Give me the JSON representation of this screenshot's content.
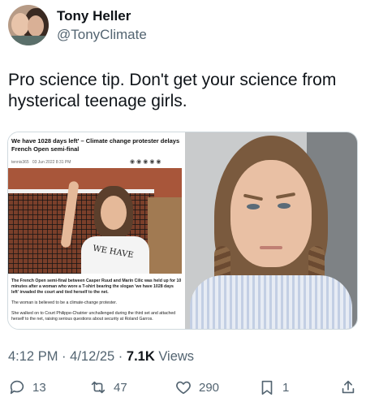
{
  "author": {
    "name": "Tony Heller",
    "handle": "@TonyClimate"
  },
  "tweet": {
    "text": "Pro science tip.  Don't get your science from hysterical teenage girls."
  },
  "article": {
    "headline": "We have 1028 days left' – Climate change protester delays French Open semi-final",
    "source": "tennis365",
    "date": "03 Jun 2022 8:31 PM",
    "shirt_text": "WE HAVE",
    "paragraphs": [
      "The French Open semi-final between Casper Ruud and Marin Cilic was held up for 10 minutes after a woman who wore a T-shirt bearing the slogan 'we have 1028 days left' invaded the court and tied herself to the net.",
      "The woman is believed to be a climate-change protester.",
      "She walked on to Court Philippe-Chatrier unchallenged during the third set and attached herself to the net, raising serious questions about security at Roland Garros."
    ]
  },
  "meta": {
    "time": "4:12 PM",
    "date": "4/12/25",
    "separator": "·",
    "views_count": "7.1K",
    "views_label": "Views"
  },
  "actions": {
    "replies": "13",
    "reposts": "47",
    "likes": "290",
    "bookmarks": "1"
  },
  "icons": [
    "reply-icon",
    "repost-icon",
    "like-icon",
    "bookmark-icon",
    "share-icon"
  ],
  "colors": {
    "text": "#0f1419",
    "secondary": "#536471",
    "border": "#cfd9de"
  }
}
